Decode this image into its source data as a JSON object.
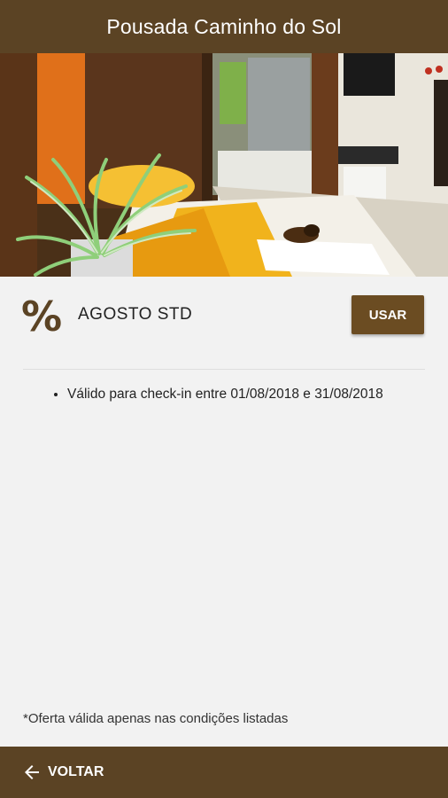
{
  "header": {
    "title": "Pousada Caminho do Sol"
  },
  "hero": {
    "alt": "room-photo"
  },
  "offer": {
    "icon": "percent-icon",
    "icon_glyph": "%",
    "name": "AGOSTO STD",
    "use_label": "USAR"
  },
  "conditions": [
    "Válido para check-in entre 01/08/2018 e 31/08/2018"
  ],
  "footnote": "*Oferta válida apenas nas condições listadas",
  "footer": {
    "back_label": "VOLTAR",
    "back_icon": "arrow-left-icon"
  },
  "colors": {
    "brand": "#5b4324",
    "button": "#6b4c22",
    "background": "#f2f2f2"
  }
}
